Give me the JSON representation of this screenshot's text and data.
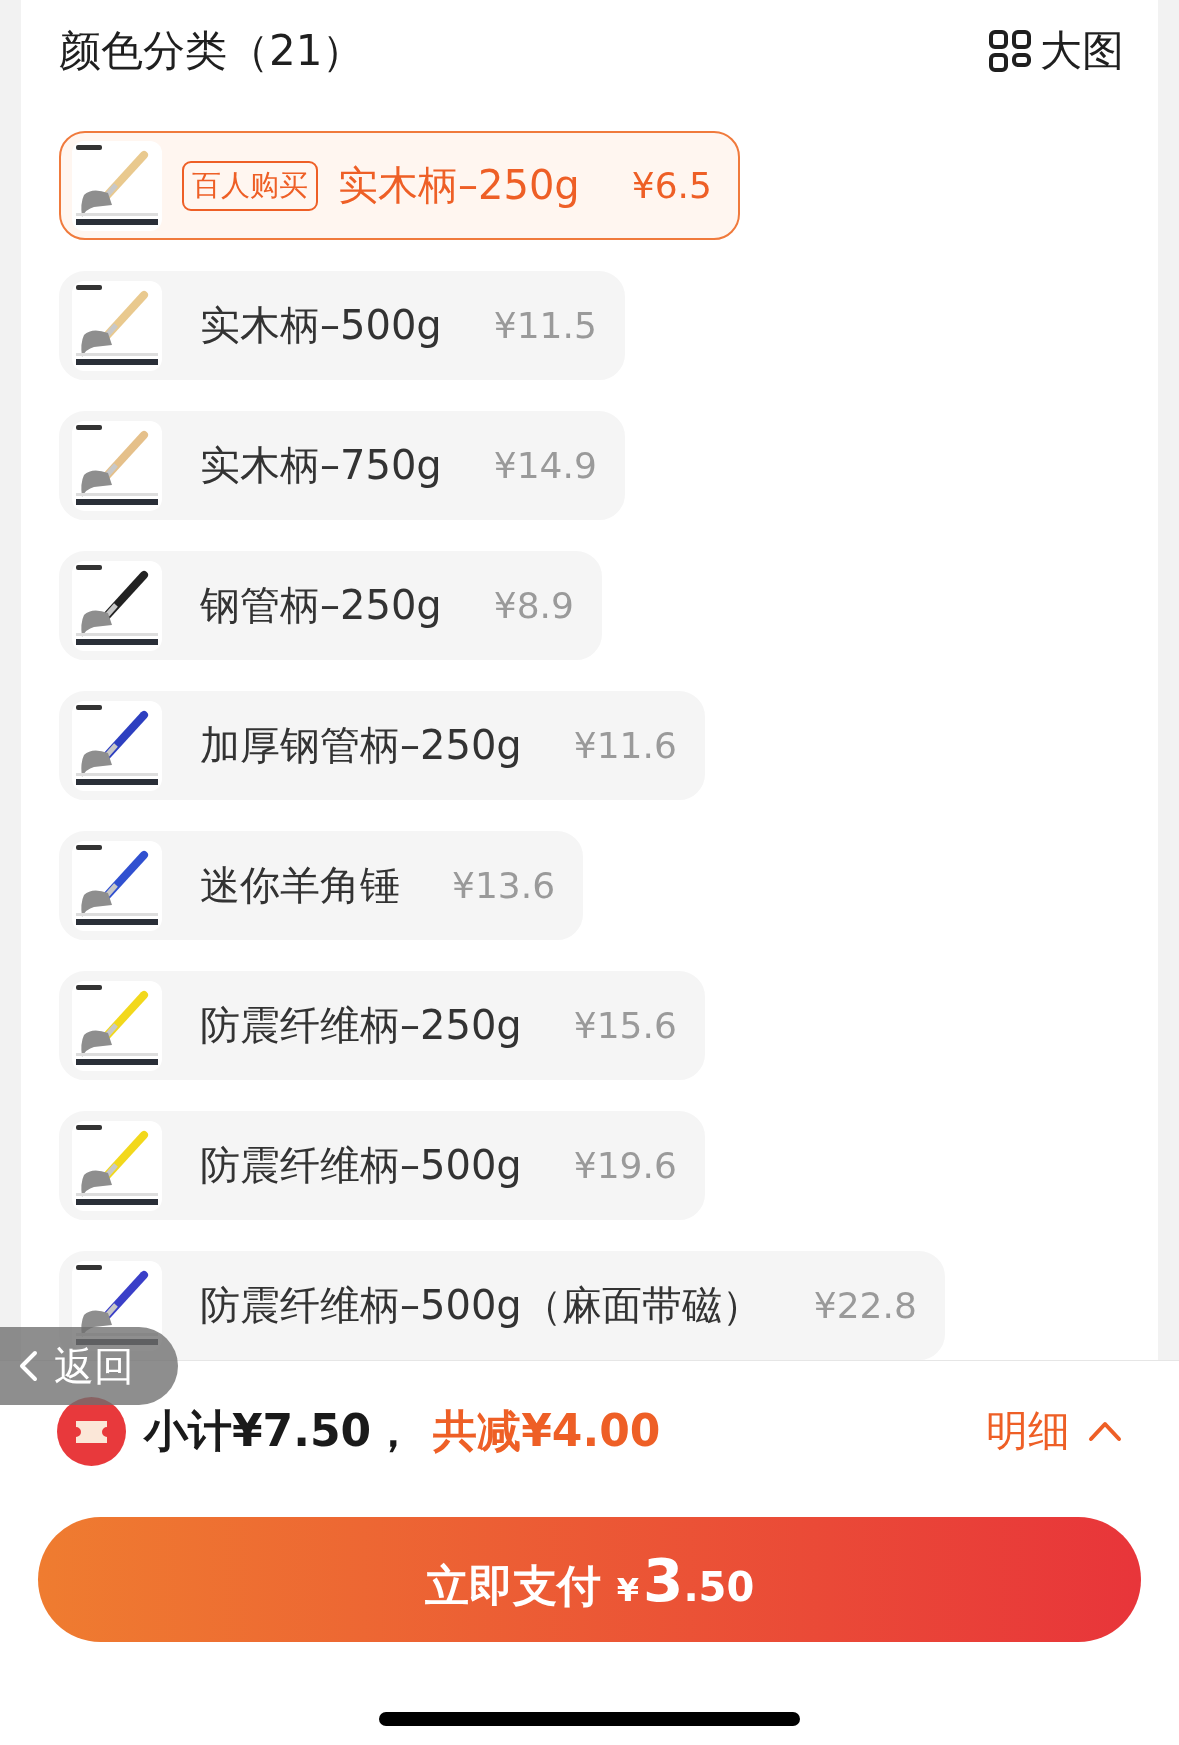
{
  "header": {
    "title": "颜色分类（21）",
    "view_toggle": "大图"
  },
  "options": [
    {
      "name": "实木柄–250g",
      "price": "¥6.5",
      "selected": true,
      "badge": "百人购买"
    },
    {
      "name": "实木柄–500g",
      "price": "¥11.5",
      "selected": false
    },
    {
      "name": "实木柄–750g",
      "price": "¥14.9",
      "selected": false
    },
    {
      "name": "钢管柄–250g",
      "price": "¥8.9",
      "selected": false
    },
    {
      "name": "加厚钢管柄–250g",
      "price": "¥11.6",
      "selected": false
    },
    {
      "name": "迷你羊角锤",
      "price": "¥13.6",
      "selected": false
    },
    {
      "name": "防震纤维柄–250g",
      "price": "¥15.6",
      "selected": false
    },
    {
      "name": "防震纤维柄–500g",
      "price": "¥19.6",
      "selected": false
    },
    {
      "name": "防震纤维柄–500g（麻面带磁）",
      "price": "¥22.8",
      "selected": false
    }
  ],
  "back_button": "返回",
  "summary": {
    "subtotal": "小计¥7.50，",
    "discount": "共减¥4.00",
    "details_link": "明细"
  },
  "pay_button": {
    "label": "立即支付",
    "currency": "¥",
    "amount_integer": "3",
    "amount_decimal": ".50"
  }
}
